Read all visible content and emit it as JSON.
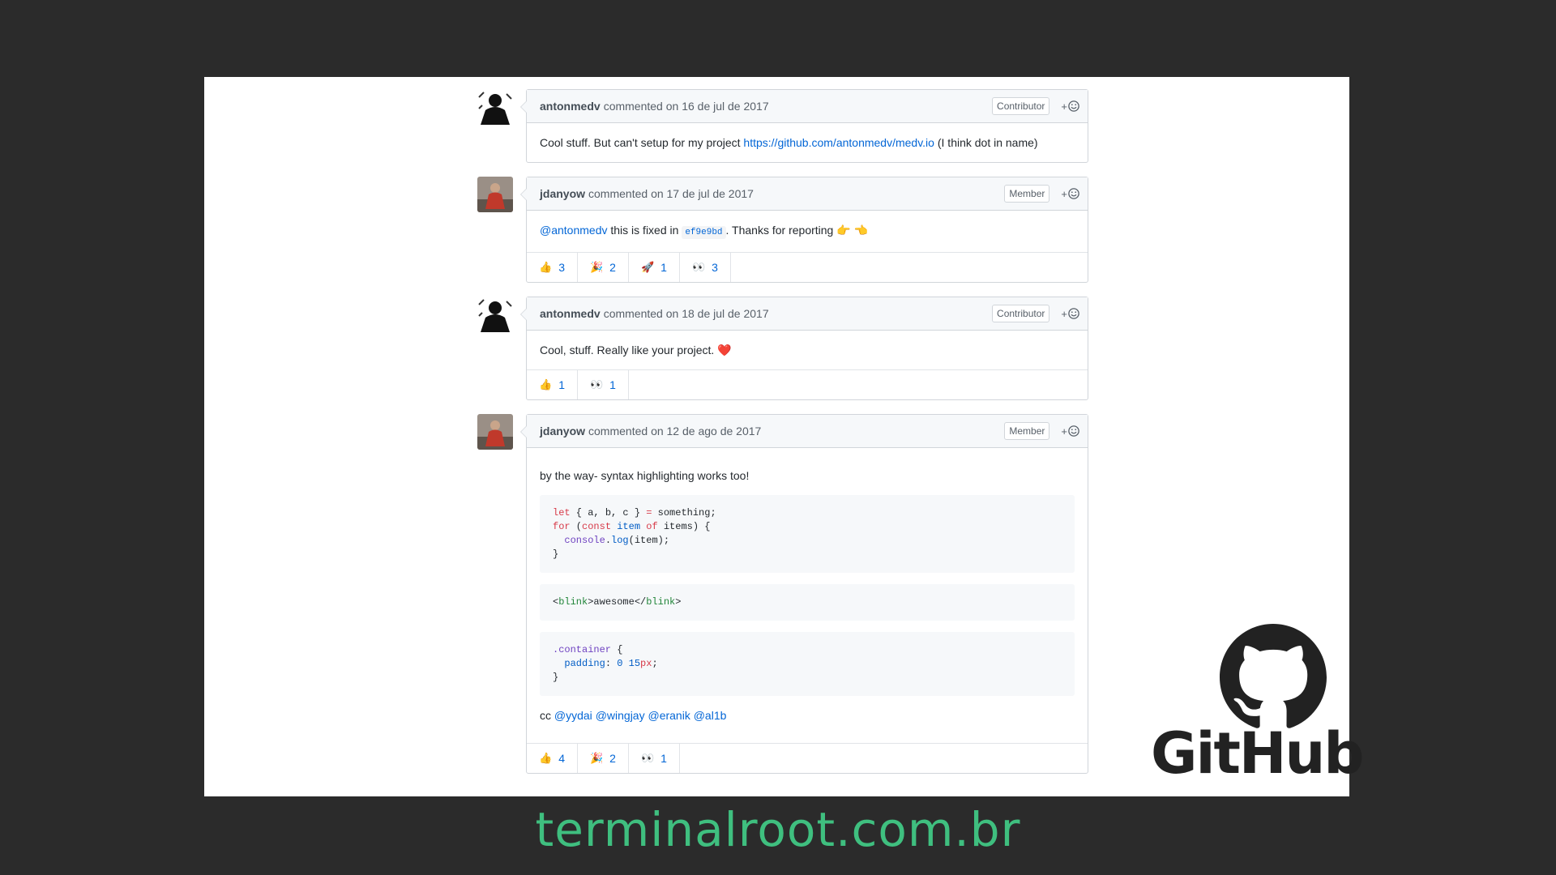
{
  "comments": [
    {
      "author": "antonmedv",
      "verb": "commented",
      "date": "on 16 de jul de 2017",
      "role": "Contributor",
      "body": {
        "text_before": "Cool stuff. But can't setup for my project ",
        "link": "https://github.com/antonmedv/medv.io",
        "text_after": " (I think dot in name)"
      }
    },
    {
      "author": "jdanyow",
      "verb": "commented",
      "date": "on 17 de jul de 2017",
      "role": "Member",
      "body": {
        "mention": "@antonmedv",
        "text_mid": " this is fixed in ",
        "sha": "ef9e9bd",
        "text_after": ". Thanks for reporting 👉 👈"
      },
      "reactions": [
        {
          "emoji": "👍",
          "count": "3"
        },
        {
          "emoji": "🎉",
          "count": "2"
        },
        {
          "emoji": "🚀",
          "count": "1"
        },
        {
          "emoji": "👀",
          "count": "3"
        }
      ]
    },
    {
      "author": "antonmedv",
      "verb": "commented",
      "date": "on 18 de jul de 2017",
      "role": "Contributor",
      "body": {
        "text": "Cool, stuff. Really like your project.",
        "heart": "❤️"
      },
      "reactions": [
        {
          "emoji": "👍",
          "count": "1"
        },
        {
          "emoji": "👀",
          "count": "1"
        }
      ]
    },
    {
      "author": "jdanyow",
      "verb": "commented",
      "date": "on 12 de ago de 2017",
      "role": "Member",
      "body": {
        "intro": "by the way- syntax highlighting works too!",
        "code_js": {
          "l1_k": "let",
          "l1_a": " { a, b, c } ",
          "l1_eq": "=",
          "l1_b": " something;",
          "l2_for": "for",
          "l2_a": " (",
          "l2_const": "const",
          "l2_item": " item",
          "l2_of": " of",
          "l2_b": " items) {",
          "l3_indent": "  ",
          "l3_console": "console",
          "l3_dot": ".",
          "l3_log": "log",
          "l3_b": "(item);",
          "l4": "}"
        },
        "code_html": {
          "lt1": "<",
          "tag1": "blink",
          "gt1": ">awesome</",
          "tag2": "blink",
          "gt2": ">"
        },
        "code_css": {
          "selector": ".container",
          "l1_b": " {",
          "indent": "  ",
          "prop": "padding",
          "colon": ": ",
          "v1": "0",
          "sp": " ",
          "v2": "15",
          "unit": "px",
          "semi": ";",
          "close": "}"
        },
        "cc_prefix": "cc ",
        "cc_mentions": [
          "@yydai",
          "@wingjay",
          "@eranik",
          "@al1b"
        ]
      },
      "reactions": [
        {
          "emoji": "👍",
          "count": "4"
        },
        {
          "emoji": "🎉",
          "count": "2"
        },
        {
          "emoji": "👀",
          "count": "1"
        }
      ]
    }
  ],
  "branding": {
    "logo_text": "GitHub",
    "site": "terminalroot.com.br"
  },
  "colors": {
    "background": "#2b2b2b",
    "link": "#0366d6",
    "site_text": "#3fbf7f"
  },
  "icons": {
    "add_reaction": "smiley-icon",
    "github_logo": "octocat-icon"
  }
}
